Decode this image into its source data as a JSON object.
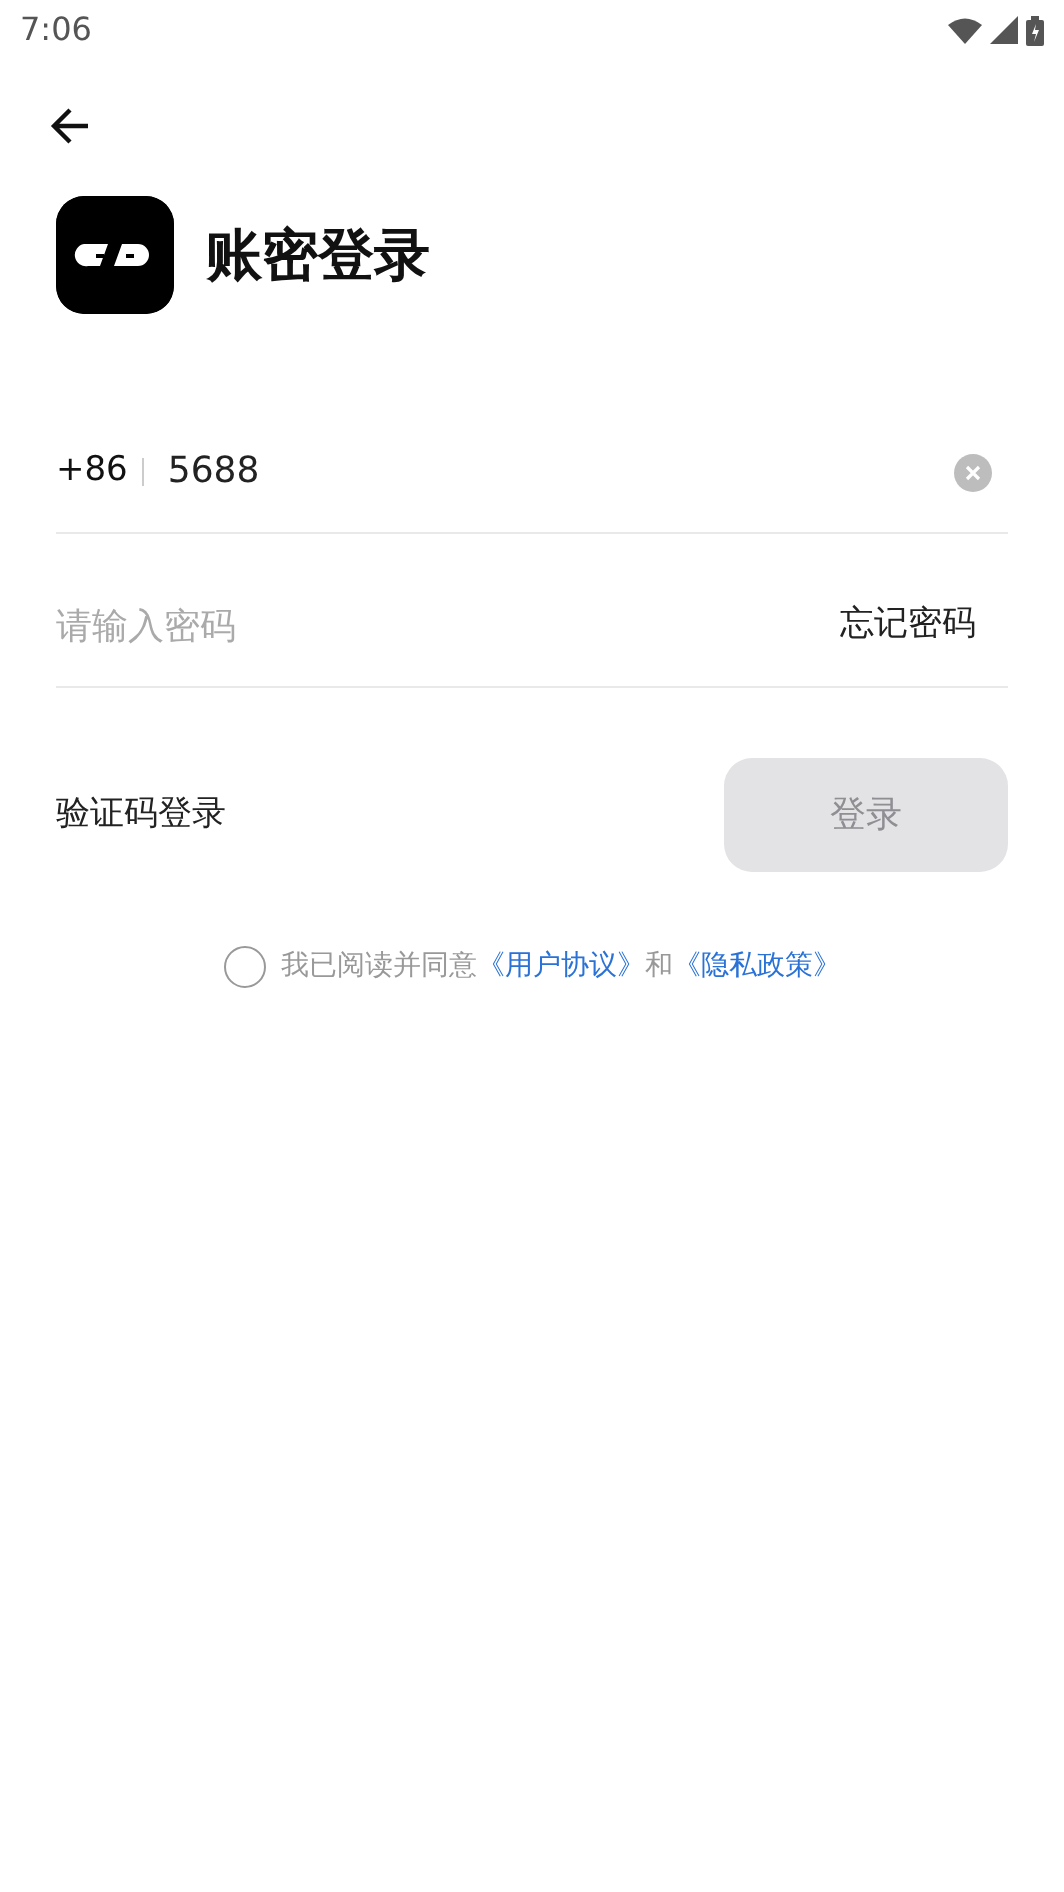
{
  "status_bar": {
    "time": "7:06"
  },
  "title": "账密登录",
  "phone": {
    "country_code": "+86",
    "value": "5688"
  },
  "password": {
    "placeholder": "请输入密码",
    "forgot_link": "忘记密码"
  },
  "code_login_link": "验证码登录",
  "login_button": {
    "label": "登录",
    "disabled": true
  },
  "agreement": {
    "checked": false,
    "text": "我已阅读并同意",
    "user_agreement": "《用户协议》",
    "and": "和",
    "privacy_policy": "《隐私政策》"
  }
}
